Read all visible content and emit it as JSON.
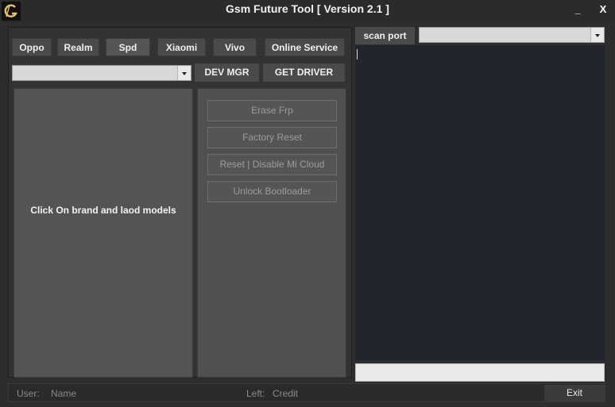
{
  "window": {
    "title": "Gsm Future Tool [ Version 2.1 ]",
    "minimize_label": "_",
    "close_label": "X",
    "logo_icon": "g-logo-icon"
  },
  "brands": [
    "Oppo",
    "Realm",
    "Spd",
    "Xiaomi",
    "Vivo",
    "Online Service"
  ],
  "model_select": {
    "value": ""
  },
  "toolbar": {
    "dev_mgr_label": "DEV MGR",
    "get_driver_label": "GET DRIVER"
  },
  "models_panel": {
    "hint": "Click On brand and laod models"
  },
  "operations": [
    "Erase Frp",
    "Factory Reset",
    "Reset | Disable Mi Cloud",
    "Unlock Bootloader"
  ],
  "port": {
    "scan_label": "scan port",
    "value": ""
  },
  "log": {
    "text": ""
  },
  "progress": {
    "value": 0
  },
  "status": {
    "user_label": "User:",
    "user_value": "Name",
    "left_label": "Left:",
    "left_value": "Credit",
    "exit_label": "Exit"
  },
  "colors": {
    "background": "#2d2d2d",
    "button": "#4a4a4a",
    "log_background": "#22252b",
    "disabled_text": "#9c9c9c"
  }
}
